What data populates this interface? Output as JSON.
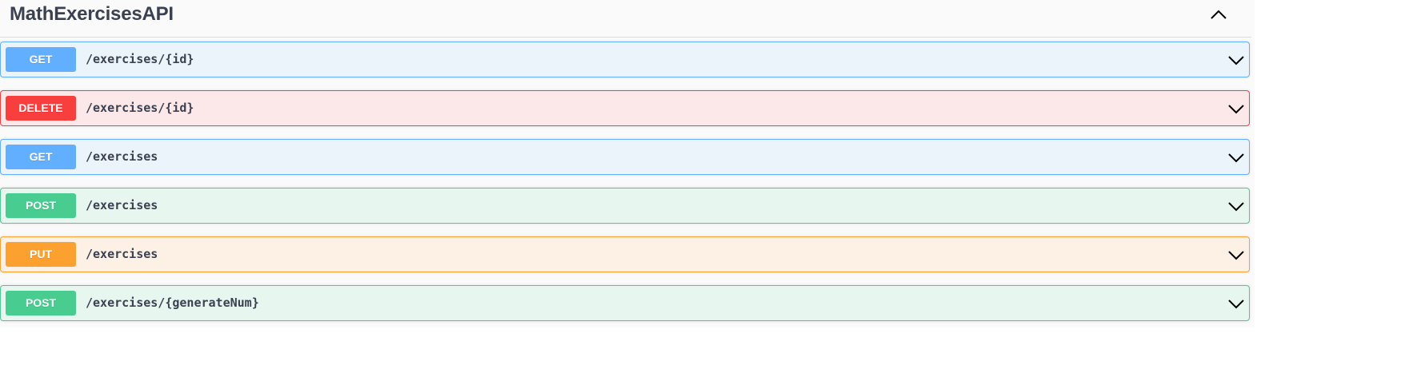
{
  "tag": {
    "title": "MathExercisesAPI"
  },
  "icons": {
    "collapse": "chevron-up-icon",
    "expand": "chevron-down-icon"
  },
  "colors": {
    "get": "#61affe",
    "delete": "#f93e3e",
    "post": "#49cc90",
    "put": "#fca130",
    "text": "#3b4151"
  },
  "operations": [
    {
      "method": "GET",
      "path": "/exercises/{id}"
    },
    {
      "method": "DELETE",
      "path": "/exercises/{id}"
    },
    {
      "method": "GET",
      "path": "/exercises"
    },
    {
      "method": "POST",
      "path": "/exercises"
    },
    {
      "method": "PUT",
      "path": "/exercises"
    },
    {
      "method": "POST",
      "path": "/exercises/{generateNum}"
    }
  ]
}
